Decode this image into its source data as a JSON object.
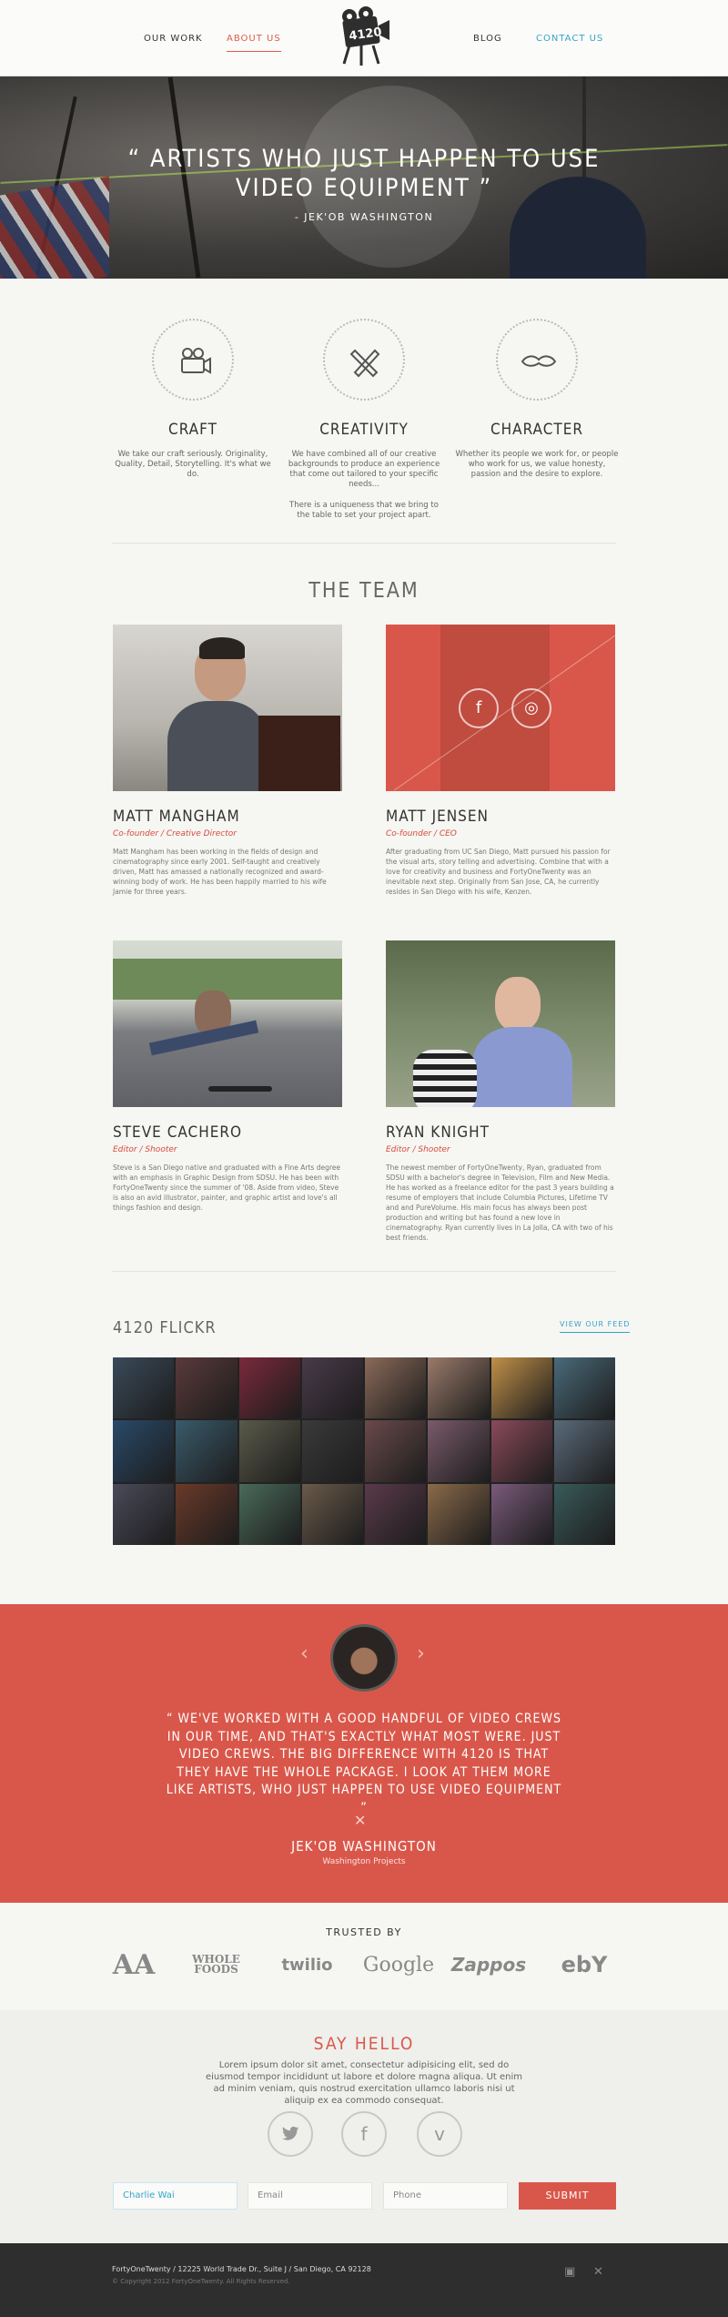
{
  "nav": {
    "items": [
      {
        "label": "OUR WORK",
        "style": "default"
      },
      {
        "label": "ABOUT US",
        "style": "active"
      },
      {
        "label": "BLOG",
        "style": "default"
      },
      {
        "label": "CONTACT US",
        "style": "highlight"
      }
    ],
    "logo_icon": "camera-logo-icon"
  },
  "hero": {
    "quote_line1": "“ ARTISTS WHO JUST HAPPEN TO USE",
    "quote_line2": "VIDEO EQUIPMENT ”",
    "byline": "- JEK'OB WASHINGTON"
  },
  "features": [
    {
      "title": "CRAFT",
      "icon": "video-camera-icon",
      "text": "We take our craft seriously. Originality, Quality, Detail, Storytelling. It's what we do.",
      "text2": ""
    },
    {
      "title": "CREATIVITY",
      "icon": "pencil-ruler-icon",
      "text": "We have combined all of our creative backgrounds to produce an experience that come out tailored to your specific needs...",
      "text2": "There is a uniqueness that we bring to the table to set your project apart."
    },
    {
      "title": "CHARACTER",
      "icon": "mustache-icon",
      "text": "Whether its people we work for, or people who work for us, we value honesty, passion and the desire to explore.",
      "text2": ""
    }
  ],
  "team": {
    "title": "THE TEAM",
    "members": [
      {
        "name": "MATT MANGHAM",
        "role": "Co-founder / Creative Director",
        "bio": "Matt Mangham has been working in the fields of design and cinematography since early 2001. Self-taught and creatively driven, Matt has amassed a nationally recognized and award-winning body of work. He has been happily married to his wife Jamie for three years."
      },
      {
        "name": "MATT JENSEN",
        "role": "Co-founder / CEO",
        "bio": "After graduating from UC San Diego, Matt pursued his passion for the visual arts, story telling and advertising. Combine that with a love for creativity and business and FortyOneTwenty was an inevitable next step. Originally from San Jose, CA, he currently resides in San Diego with his wife, Kenzen."
      },
      {
        "name": "STEVE CACHERO",
        "role": "Editor / Shooter",
        "bio": "Steve is a San Diego native and graduated with a Fine Arts degree with an emphasis in Graphic Design from SDSU.  He has been with FortyOneTwenty since the summer of '08.  Aside from video, Steve is also an avid illustrator, painter, and graphic artist and love's all things fashion and design."
      },
      {
        "name": "RYAN KNIGHT",
        "role": "Editor / Shooter",
        "bio": "The newest member of FortyOneTwenty, Ryan, graduated from SDSU with a bachelor's degree in Television, Film and New Media. He has worked as a freelance editor for the past 3 years building a resume of employers that include Columbia Pictures, Lifetime TV and and PureVolume. His main focus has always been post production and writing but has found a new love in cinematography. Ryan currently lives in La Jolla, CA with two of his best friends."
      }
    ],
    "social": [
      "facebook-icon",
      "instagram-icon"
    ]
  },
  "flickr": {
    "title": "4120 FLICKR",
    "link": "VIEW OUR FEED",
    "tiles": [
      "#3a4a5a",
      "#5a3a3a",
      "#7a2a3a",
      "#4a3a4a",
      "#8a6a5a",
      "#9a7a6a",
      "#c0904a",
      "#4a6a7a",
      "#2a4a6a",
      "#3a5a6a",
      "#5a5a4a",
      "#3a3a3a",
      "#6a4a4a",
      "#7a5a6a",
      "#8a4a5a",
      "#5a6a7a",
      "#4a4a5a",
      "#6a3a2a",
      "#4a6a5a",
      "#6a5a4a",
      "#5a3a4a",
      "#8a6a4a",
      "#7a5a7a",
      "#3a5a5a"
    ]
  },
  "testimonial": {
    "quote": "“ WE'VE WORKED WITH A GOOD HANDFUL OF VIDEO CREWS IN OUR TIME, AND THAT'S EXACTLY WHAT MOST WERE. JUST VIDEO CREWS. THE BIG DIFFERENCE WITH 4120 IS THAT THEY HAVE THE WHOLE PACKAGE. I LOOK AT THEM MORE LIKE ARTISTS, WHO JUST HAPPEN TO USE VIDEO EQUIPMENT ”",
    "name": "JEK'OB WASHINGTON",
    "company": "Washington Projects",
    "prev_icon": "chevron-left-icon",
    "next_icon": "chevron-right-icon"
  },
  "trusted": {
    "title": "TRUSTED BY",
    "clients": [
      "AA",
      "WHOLE FOODS",
      "twilio",
      "Google",
      "Zappos",
      "ebY"
    ]
  },
  "hello": {
    "title": "SAY HELLO",
    "text": "Lorem ipsum dolor sit amet, consectetur adipisicing elit, sed do eiusmod tempor incididunt ut labore et dolore magna aliqua. Ut enim ad minim veniam, quis nostrud exercitation ullamco laboris nisi ut aliquip ex ea commodo consequat.",
    "social": [
      "twitter-icon",
      "facebook-icon",
      "vimeo-icon"
    ],
    "name_value": "Charlie Wai",
    "email_placeholder": "Email",
    "phone_placeholder": "Phone",
    "submit": "SUBMIT"
  },
  "footer": {
    "address": "FortyOneTwenty / 12225 World Trade Dr., Suite J / San Diego, CA 92128",
    "copyright": "© Copyright 2012 FortyOneTwenty. All Rights Reserved."
  }
}
